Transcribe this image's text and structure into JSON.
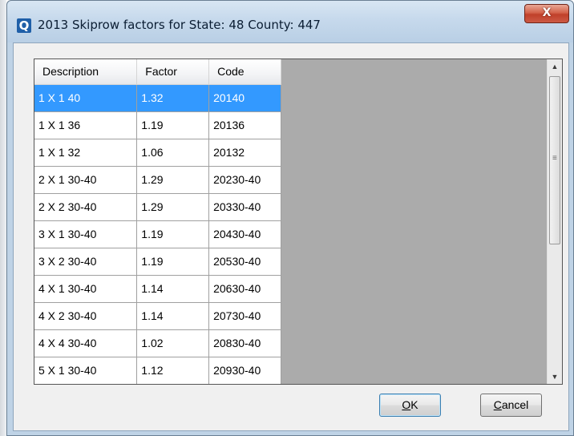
{
  "window": {
    "app_icon_letter": "Q",
    "title": "2013 Skiprow factors for State: 48 County: 447",
    "close_glyph": "X"
  },
  "table": {
    "columns": [
      "Description",
      "Factor",
      "Code"
    ],
    "selected_row": 0,
    "rows": [
      [
        "1 X 1 40",
        "1.32",
        "20140"
      ],
      [
        "1 X 1 36",
        "1.19",
        "20136"
      ],
      [
        "1 X 1 32",
        "1.06",
        "20132"
      ],
      [
        "2 X 1 30-40",
        "1.29",
        "20230-40"
      ],
      [
        "2 X 2 30-40",
        "1.29",
        "20330-40"
      ],
      [
        "3 X 1 30-40",
        "1.19",
        "20430-40"
      ],
      [
        "3 X 2 30-40",
        "1.19",
        "20530-40"
      ],
      [
        "4 X 1 30-40",
        "1.14",
        "20630-40"
      ],
      [
        "4 X 2 30-40",
        "1.14",
        "20730-40"
      ],
      [
        "4 X 4 30-40",
        "1.02",
        "20830-40"
      ],
      [
        "5 X 1 30-40",
        "1.12",
        "20930-40"
      ],
      [
        "",
        "",
        ""
      ]
    ]
  },
  "scrollbar": {
    "up_icon": "scroll-up-arrow-icon",
    "down_icon": "scroll-down-arrow-icon",
    "grip_glyph": "≡"
  },
  "buttons": {
    "ok_mnemonic": "O",
    "ok_rest": "K",
    "cancel_mnemonic": "C",
    "cancel_rest": "ancel"
  },
  "colors": {
    "selection": "#3399ff",
    "close_button": "#c0402a",
    "app_icon": "#1f5fa8"
  }
}
